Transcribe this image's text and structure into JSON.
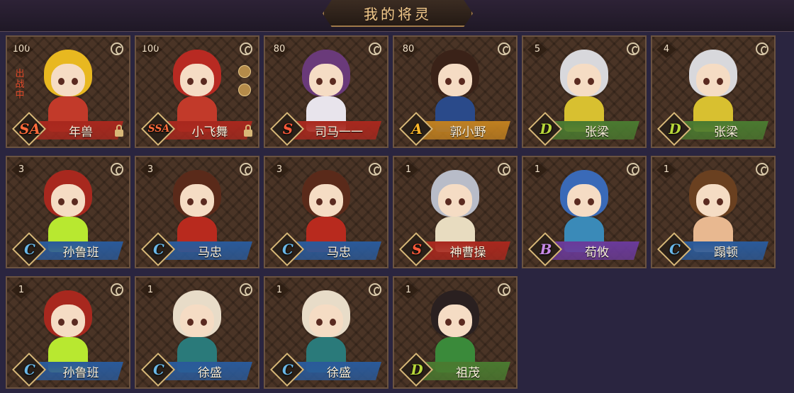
{
  "header": {
    "title": "我的将灵"
  },
  "ui": {
    "in_battle_label": "出战中"
  },
  "cards": [
    {
      "level": "100",
      "rank": "SA",
      "name": "年兽",
      "bar_color": "#a8281e",
      "rank_color": "#ff6a3a",
      "hair": "#e8b820",
      "body": "#c23a2a",
      "in_battle": true,
      "locked": true,
      "extra_icons": []
    },
    {
      "level": "100",
      "rank": "SSA",
      "name": "小飞舞",
      "bar_color": "#a8281e",
      "rank_color": "#ff6a3a",
      "hair": "#b82a22",
      "body": "#c23a2a",
      "in_battle": false,
      "locked": true,
      "extra_icons": [
        "bowl-icon",
        "scroll-icon"
      ]
    },
    {
      "level": "80",
      "rank": "S",
      "name": "司马一一",
      "bar_color": "#a8281e",
      "rank_color": "#ff5a3a",
      "hair": "#6a3a7a",
      "body": "#e8e4ec",
      "in_battle": false,
      "locked": false,
      "extra_icons": []
    },
    {
      "level": "80",
      "rank": "A",
      "name": "郭小野",
      "bar_color": "#c08020",
      "rank_color": "#ffb82a",
      "hair": "#3a2218",
      "body": "#2a4a8a",
      "in_battle": false,
      "locked": false,
      "extra_icons": []
    },
    {
      "level": "5",
      "rank": "D",
      "name": "张梁",
      "bar_color": "#4a7a30",
      "rank_color": "#b8d83a",
      "hair": "#d8d8dc",
      "body": "#d8c030",
      "in_battle": false,
      "locked": false,
      "extra_icons": []
    },
    {
      "level": "4",
      "rank": "D",
      "name": "张梁",
      "bar_color": "#4a7a30",
      "rank_color": "#b8d83a",
      "hair": "#d8d8dc",
      "body": "#d8c030",
      "in_battle": false,
      "locked": false,
      "extra_icons": []
    },
    {
      "level": "3",
      "rank": "C",
      "name": "孙鲁班",
      "bar_color": "#2a5a9a",
      "rank_color": "#6ab8e8",
      "hair": "#a8281e",
      "body": "#b8e830",
      "in_battle": false,
      "locked": false,
      "extra_icons": []
    },
    {
      "level": "3",
      "rank": "C",
      "name": "马忠",
      "bar_color": "#2a5a9a",
      "rank_color": "#6ab8e8",
      "hair": "#5a2a1a",
      "body": "#b82a1e",
      "in_battle": false,
      "locked": false,
      "extra_icons": []
    },
    {
      "level": "3",
      "rank": "C",
      "name": "马忠",
      "bar_color": "#2a5a9a",
      "rank_color": "#6ab8e8",
      "hair": "#5a2a1a",
      "body": "#b82a1e",
      "in_battle": false,
      "locked": false,
      "extra_icons": []
    },
    {
      "level": "1",
      "rank": "S",
      "name": "神曹操",
      "bar_color": "#a8281e",
      "rank_color": "#ff5a3a",
      "hair": "#b8bcc8",
      "body": "#e8dcc0",
      "in_battle": false,
      "locked": false,
      "extra_icons": []
    },
    {
      "level": "1",
      "rank": "B",
      "name": "荀攸",
      "bar_color": "#6a3a9a",
      "rank_color": "#c88ae8",
      "hair": "#3a6ab8",
      "body": "#3a8ab8",
      "in_battle": false,
      "locked": false,
      "extra_icons": []
    },
    {
      "level": "1",
      "rank": "C",
      "name": "蹋顿",
      "bar_color": "#2a5a9a",
      "rank_color": "#6ab8e8",
      "hair": "#6a4020",
      "body": "#e8b890",
      "in_battle": false,
      "locked": false,
      "extra_icons": []
    },
    {
      "level": "1",
      "rank": "C",
      "name": "孙鲁班",
      "bar_color": "#2a5a9a",
      "rank_color": "#6ab8e8",
      "hair": "#a8281e",
      "body": "#b8e830",
      "in_battle": false,
      "locked": false,
      "extra_icons": []
    },
    {
      "level": "1",
      "rank": "C",
      "name": "徐盛",
      "bar_color": "#2a5a9a",
      "rank_color": "#6ab8e8",
      "hair": "#e8dcc8",
      "body": "#2a7a7a",
      "in_battle": false,
      "locked": false,
      "extra_icons": []
    },
    {
      "level": "1",
      "rank": "C",
      "name": "徐盛",
      "bar_color": "#2a5a9a",
      "rank_color": "#6ab8e8",
      "hair": "#e8dcc8",
      "body": "#2a7a7a",
      "in_battle": false,
      "locked": false,
      "extra_icons": []
    },
    {
      "level": "1",
      "rank": "D",
      "name": "祖茂",
      "bar_color": "#4a7a30",
      "rank_color": "#b8d83a",
      "hair": "#2a2020",
      "body": "#3a8a3a",
      "in_battle": false,
      "locked": false,
      "extra_icons": []
    }
  ]
}
